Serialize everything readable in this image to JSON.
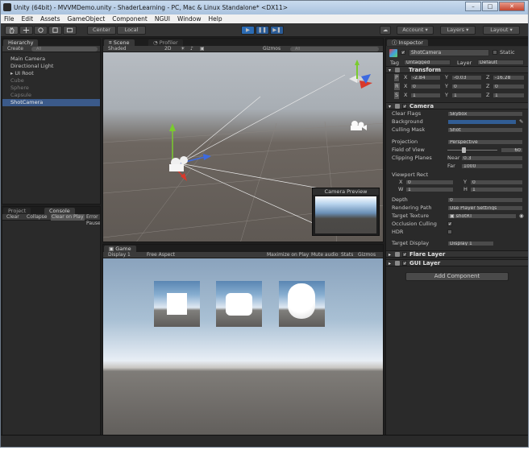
{
  "window": {
    "title": "Unity (64bit) - MVVMDemo.unity - ShaderLearning - PC, Mac & Linux Standalone* <DX11>",
    "minimize": "–",
    "maximize": "□",
    "close": "✕"
  },
  "menu": [
    "File",
    "Edit",
    "Assets",
    "GameObject",
    "Component",
    "NGUI",
    "Window",
    "Help"
  ],
  "toolbar": {
    "center": "Center",
    "local": "Local",
    "account": "Account",
    "layers": "Layers",
    "layout": "Layout",
    "play": "▶",
    "pause": "❚❚",
    "step": "▶❚"
  },
  "hierarchy": {
    "tab": "Hierarchy",
    "create": "Create",
    "search": "All",
    "items": [
      {
        "label": "Main Camera",
        "dim": false,
        "selected": false
      },
      {
        "label": "Directional Light",
        "dim": false,
        "selected": false
      },
      {
        "label": "▸ UI Root",
        "dim": false,
        "selected": false
      },
      {
        "label": "Cube",
        "dim": true,
        "selected": false
      },
      {
        "label": "Sphere",
        "dim": true,
        "selected": false
      },
      {
        "label": "Capsule",
        "dim": true,
        "selected": false
      },
      {
        "label": "ShotCamera",
        "dim": false,
        "selected": true
      }
    ]
  },
  "project": {
    "tab": "Project",
    "console_tab": "Console",
    "clear": "Clear",
    "collapse": "Collapse",
    "clear_on_play": "Clear on Play",
    "error_pause": "Error Pause"
  },
  "scene": {
    "tab": "Scene",
    "profiler_tab": "Profiler",
    "shaded": "Shaded",
    "mode2d": "2D",
    "gizmos": "Gizmos",
    "search": "All",
    "preview_title": "Camera Preview"
  },
  "game": {
    "tab": "Game",
    "display": "Display 1",
    "aspect": "Free Aspect",
    "maximize_on_play": "Maximize on Play",
    "mute_audio": "Mute audio",
    "stats": "Stats",
    "gizmos": "Gizmos"
  },
  "inspector": {
    "tab": "Inspector",
    "object_name": "ShotCamera",
    "static": "Static",
    "tag_label": "Tag",
    "tag": "Untagged",
    "layer_label": "Layer",
    "layer": "Default",
    "transform": {
      "title": "Transform",
      "position": {
        "label": "P",
        "x": "-2.84",
        "y": "-0.03",
        "z": "-16.28"
      },
      "rotation": {
        "label": "R",
        "x": "0",
        "y": "0",
        "z": "0"
      },
      "scale": {
        "label": "S",
        "x": "1",
        "y": "1",
        "z": "1"
      }
    },
    "camera": {
      "title": "Camera",
      "clear_flags_label": "Clear Flags",
      "clear_flags": "Skybox",
      "background_label": "Background",
      "culling_mask_label": "Culling Mask",
      "culling_mask": "Shot",
      "projection_label": "Projection",
      "projection": "Perspective",
      "fov_label": "Field of View",
      "fov": "60",
      "fov_fraction": 0.33,
      "clipping_label": "Clipping Planes",
      "near_label": "Near",
      "near": "0.3",
      "far_label": "Far",
      "far": "1000",
      "viewport_label": "Viewport Rect",
      "vx": "0",
      "vy": "0",
      "vw": "1",
      "vh": "1",
      "depth_label": "Depth",
      "depth": "0",
      "rendering_path_label": "Rendering Path",
      "rendering_path": "Use Player Settings",
      "target_texture_label": "Target Texture",
      "target_texture": "▣ shotRT",
      "occlusion_label": "Occlusion Culling",
      "occlusion": "✓",
      "hdr_label": "HDR",
      "target_display_label": "Target Display",
      "target_display": "Display 1"
    },
    "flare_layer": "Flare Layer",
    "gui_layer": "GUI Layer",
    "add_component": "Add Component"
  },
  "colors": {
    "accent": "#2c6bb3",
    "selection": "#3b5a8a",
    "camera_background": "#315d94"
  }
}
